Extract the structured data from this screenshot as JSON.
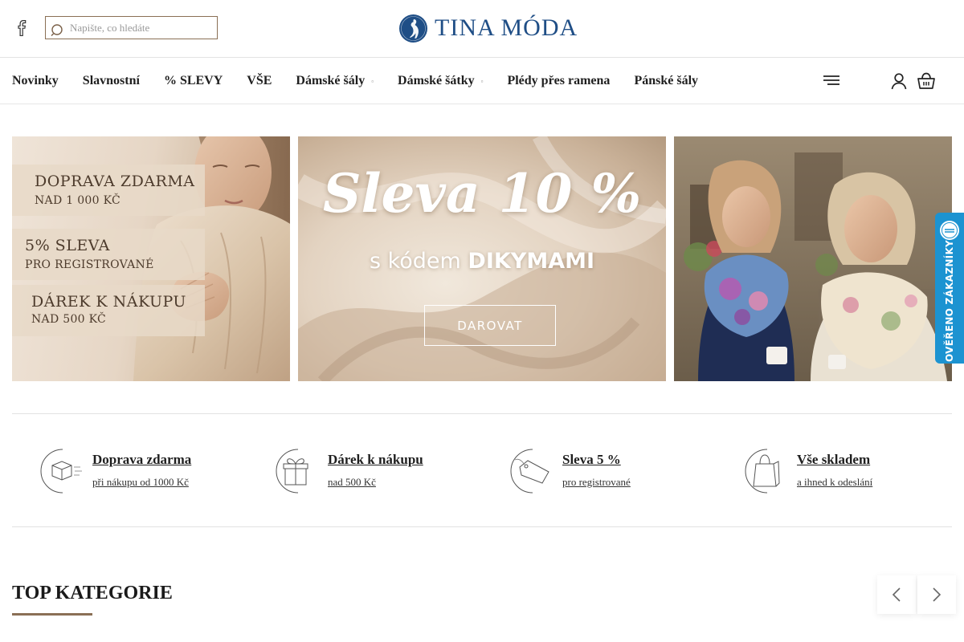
{
  "header": {
    "search_placeholder": "Napište, co hledáte",
    "logo_text": "TINA MÓDA"
  },
  "nav": {
    "items": [
      {
        "label": "Novinky",
        "has_dropdown": false
      },
      {
        "label": "Slavnostní",
        "has_dropdown": false
      },
      {
        "label": "% SLEVY",
        "has_dropdown": false
      },
      {
        "label": "VŠE",
        "has_dropdown": false
      },
      {
        "label": "Dámské šály",
        "has_dropdown": true
      },
      {
        "label": "Dámské šátky",
        "has_dropdown": true
      },
      {
        "label": "Plédy přes ramena",
        "has_dropdown": false
      },
      {
        "label": "Pánské šály",
        "has_dropdown": false
      }
    ],
    "caret": "▫"
  },
  "banners": {
    "left": {
      "promos": [
        {
          "main": "DOPRAVA ZDARMA",
          "sub": "NAD 1 000 KČ"
        },
        {
          "main": "5% SLEVA",
          "sub": "PRO REGISTROVANÉ"
        },
        {
          "main": "DÁREK K NÁKUPU",
          "sub": "NAD 500 KČ"
        }
      ]
    },
    "center": {
      "title": "Sleva 10 %",
      "code_prefix": "s kódem ",
      "code": "DIKYMAMI",
      "button_label": "DAROVAT"
    }
  },
  "verified_badge": {
    "text": "OVĚŘENO ZÁKAZNÍKY"
  },
  "benefits": [
    {
      "title": "Doprava zdarma",
      "subtitle": "při nákupu od 1000 Kč",
      "icon": "box-icon"
    },
    {
      "title": "Dárek k nákupu",
      "subtitle": "nad 500 Kč",
      "icon": "gift-icon"
    },
    {
      "title": "Sleva 5 %",
      "subtitle": "pro registrované",
      "icon": "tag-icon"
    },
    {
      "title": "Vše skladem",
      "subtitle": "a ihned k odeslání",
      "icon": "shopping-bag-icon"
    }
  ],
  "top_categories": {
    "title": "TOP KATEGORIE"
  },
  "colors": {
    "brand_blue": "#1f4e86",
    "accent_brown": "#8a6f55",
    "badge_blue": "#1c93d1"
  }
}
